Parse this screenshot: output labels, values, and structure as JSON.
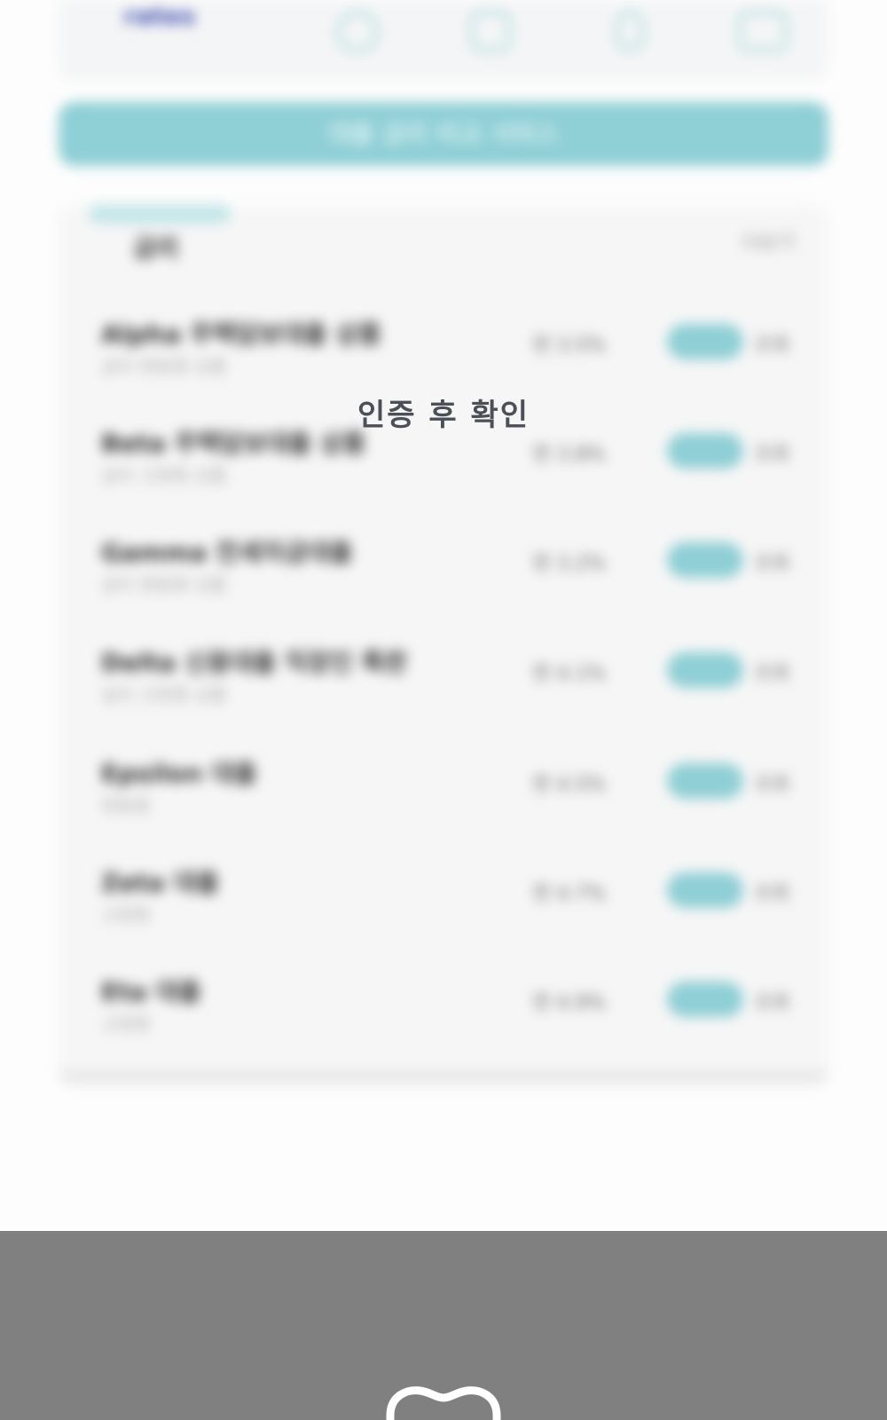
{
  "header": {
    "logo_text": "rates",
    "nav_icons": [
      "home-icon",
      "chart-icon",
      "person-icon",
      "menu-icon"
    ]
  },
  "banner": {
    "text": "대출 금리 비교 서비스"
  },
  "list": {
    "tab_label": "금리",
    "more_label": "더보기",
    "rows": [
      {
        "name": "Alpha 주택담보대출 상품",
        "sub": "금리 변동형 상품",
        "rate": "연 3.5%",
        "unit": "조회"
      },
      {
        "name": "Beta 주택담보대출 상품",
        "sub": "금리 고정형 상품",
        "rate": "연 3.8%",
        "unit": "조회"
      },
      {
        "name": "Gamma 전세자금대출",
        "sub": "금리 변동형 상품",
        "rate": "연 3.2%",
        "unit": "조회"
      },
      {
        "name": "Delta 신용대출 직장인 특판",
        "sub": "금리 고정형 상품",
        "rate": "연 4.1%",
        "unit": "조회"
      },
      {
        "name": "Epsilon 대출",
        "sub": "변동형",
        "rate": "연 4.5%",
        "unit": "조회"
      },
      {
        "name": "Zeta 대출",
        "sub": "고정형",
        "rate": "연 4.7%",
        "unit": "조회"
      },
      {
        "name": "Eta 대출",
        "sub": "고정형",
        "rate": "연 4.9%",
        "unit": "조회"
      }
    ]
  },
  "overlay": {
    "message": "인증 후 확인"
  },
  "colors": {
    "accent": "#8fcfd6",
    "footer": "#808080",
    "overlay_text": "#4a4f58"
  },
  "footer": {
    "icon": "tooth-logo-icon"
  }
}
